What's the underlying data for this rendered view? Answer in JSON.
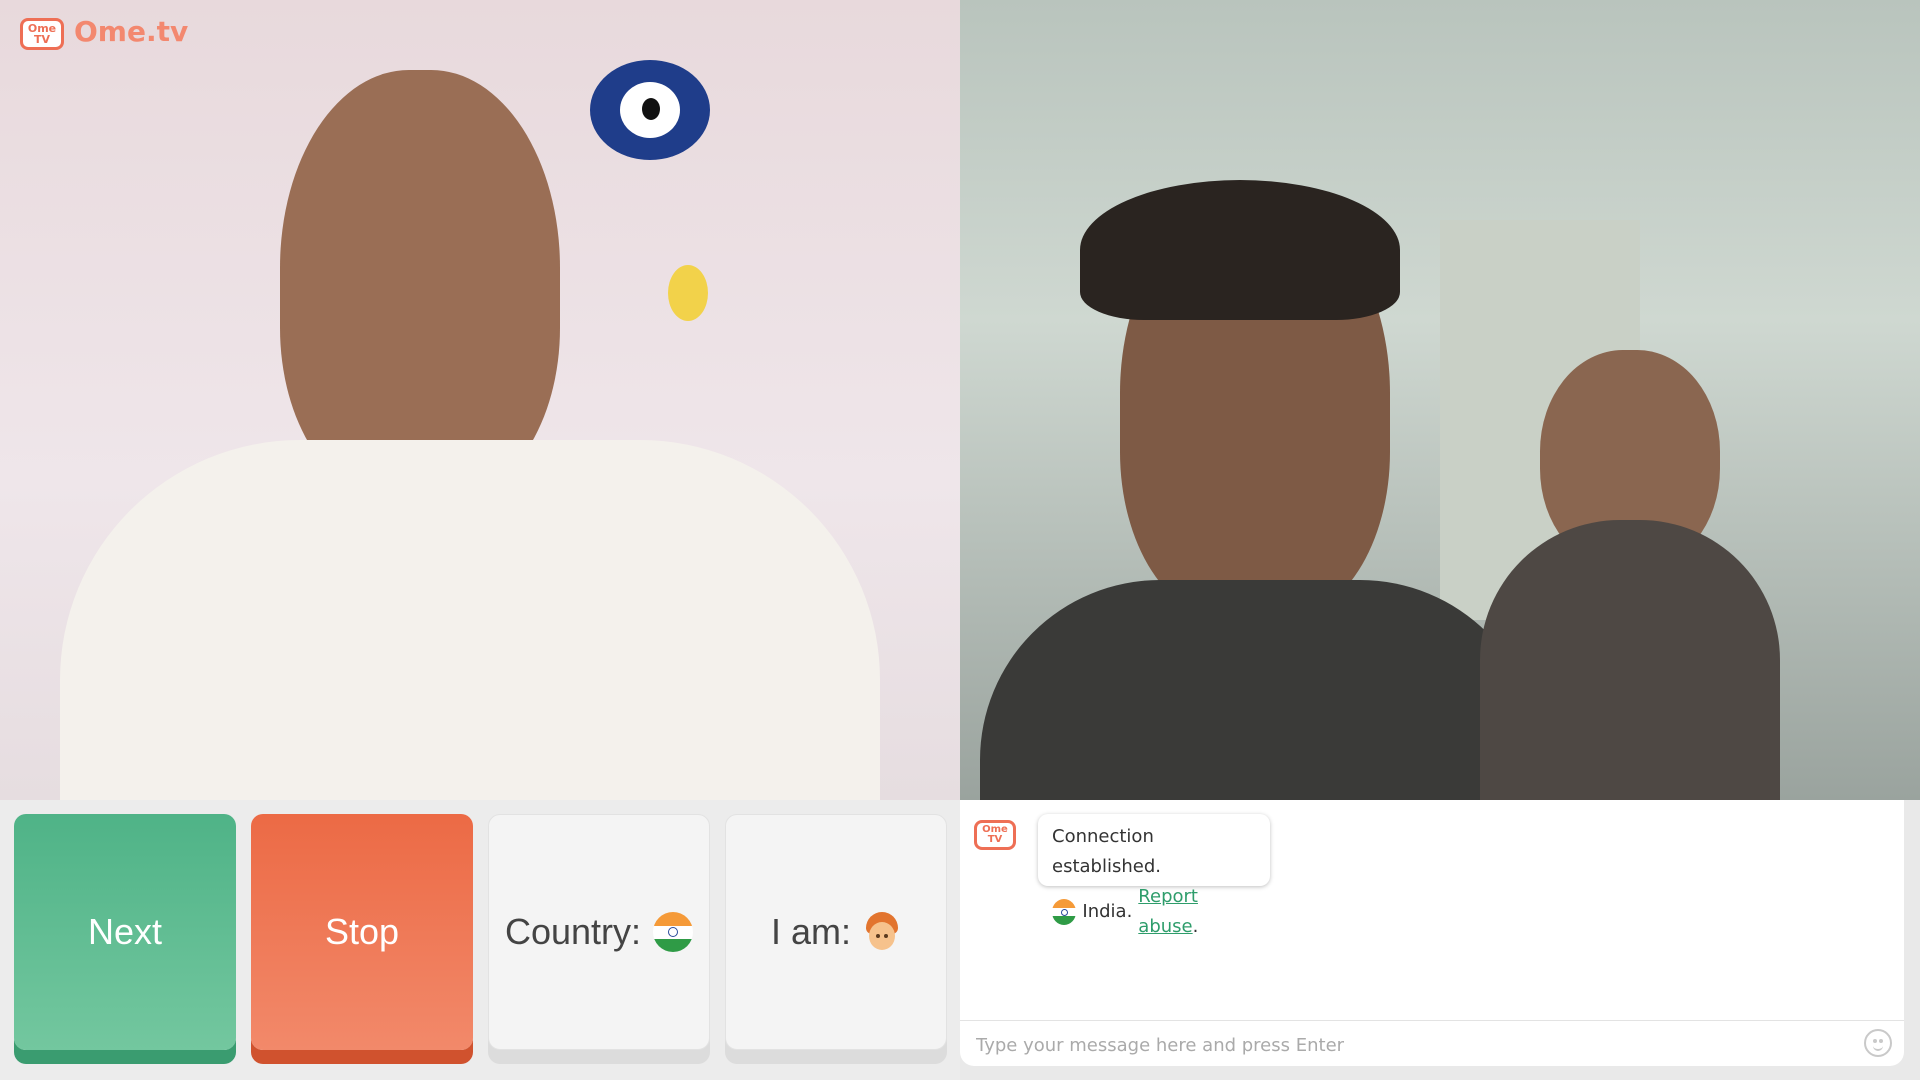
{
  "brand": {
    "logo_text": "Ome.tv",
    "badge_text": "Ome\nTV"
  },
  "controls": {
    "next_label": "Next",
    "stop_label": "Stop",
    "country_label": "Country:",
    "country_flag": "india-flag-icon",
    "iam_label": "I am:",
    "iam_icon": "boy-icon"
  },
  "chat": {
    "system_message": {
      "line1": "Connection established.",
      "country": "India.",
      "report_link": "Report abuse",
      "period": "."
    },
    "input_placeholder": "Type your message here and press Enter",
    "emoji_icon": "smiley-icon"
  },
  "colors": {
    "next": "#4fb387",
    "stop": "#ec6a45",
    "brand": "#ee6f55",
    "link": "#2e9d6b"
  }
}
